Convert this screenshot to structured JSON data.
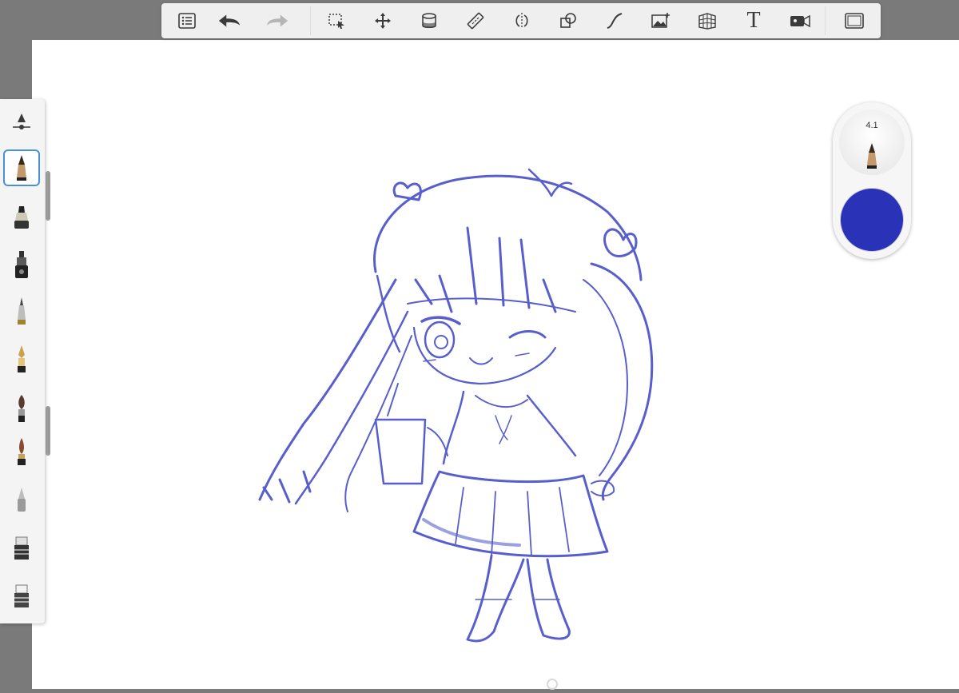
{
  "colors": {
    "app_background": "#7a7a7a",
    "canvas": "#ffffff",
    "stroke": "#3c44c4",
    "current_color": "#2a33b8"
  },
  "toolbar": {
    "items": [
      {
        "name": "menu",
        "icon": "list-icon"
      },
      {
        "name": "undo",
        "icon": "undo-arrow-icon"
      },
      {
        "name": "redo",
        "icon": "redo-arrow-icon"
      },
      {
        "name": "selection",
        "icon": "lasso-select-icon"
      },
      {
        "name": "transform",
        "icon": "move-arrows-icon"
      },
      {
        "name": "fill",
        "icon": "paint-bucket-icon"
      },
      {
        "name": "ruler",
        "icon": "ruler-icon"
      },
      {
        "name": "symmetry",
        "icon": "symmetry-icon"
      },
      {
        "name": "shapes",
        "icon": "shapes-icon"
      },
      {
        "name": "curve",
        "icon": "curve-icon"
      },
      {
        "name": "import-image",
        "icon": "image-add-icon"
      },
      {
        "name": "perspective",
        "icon": "perspective-grid-icon"
      },
      {
        "name": "text",
        "icon": "text-icon",
        "label": "T"
      },
      {
        "name": "record",
        "icon": "video-camera-icon"
      },
      {
        "name": "fullscreen",
        "icon": "fullscreen-frame-icon"
      }
    ]
  },
  "brushes": {
    "items": [
      {
        "name": "brush-settings",
        "icon": "brush-settings-slider-icon"
      },
      {
        "name": "pencil",
        "icon": "pencil-icon",
        "selected": true
      },
      {
        "name": "marker",
        "icon": "marker-icon"
      },
      {
        "name": "ink-pen",
        "icon": "ink-pen-icon"
      },
      {
        "name": "ballpoint",
        "icon": "ballpoint-pen-icon"
      },
      {
        "name": "fountain-pen",
        "icon": "fountain-pen-icon"
      },
      {
        "name": "paintbrush",
        "icon": "paintbrush-icon"
      },
      {
        "name": "round-brush",
        "icon": "round-brush-icon"
      },
      {
        "name": "airbrush",
        "icon": "airbrush-icon"
      },
      {
        "name": "soft-eraser",
        "icon": "soft-eraser-icon"
      },
      {
        "name": "hard-eraser",
        "icon": "hard-eraser-icon"
      }
    ]
  },
  "puck": {
    "brush_size": "4.1",
    "brush_icon": "pencil-icon",
    "color": "#2a33b8"
  },
  "artwork": {
    "subject": "chibi-girl-sketch"
  }
}
